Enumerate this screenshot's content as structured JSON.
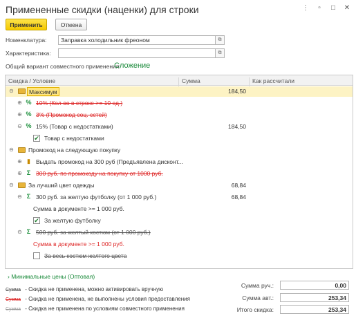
{
  "window": {
    "title": "Примененные скидки (наценки) для строки",
    "menu_glyph": "⋮",
    "restore_glyph": "▫",
    "maximize_glyph": "□",
    "close_glyph": "✕"
  },
  "toolbar": {
    "apply_label": "Применить",
    "cancel_label": "Отмена"
  },
  "form": {
    "nomenclature_label": "Номенклатура:",
    "nomenclature_value": "Заправка холодильник фреоном",
    "characteristic_label": "Характеристика:",
    "characteristic_value": "",
    "mode_label": "Общий вариант совместного применения:",
    "mode_value": "Сложение"
  },
  "grid": {
    "columns": [
      "Скидка / Условие",
      "Сумма",
      "Как рассчитали"
    ],
    "rows": [
      {
        "text": "Максимум",
        "amount": "184,50"
      },
      {
        "text": "10% (Кол-во в строке >= 10 ед.)",
        "amount": ""
      },
      {
        "text": "3% (Промокод соц. сетей)",
        "amount": ""
      },
      {
        "text": "15% (Товар с недостатками)",
        "amount": "184,50"
      },
      {
        "text": "Товар с недостатками",
        "amount": ""
      },
      {
        "text": "Промокод на следующую покупку",
        "amount": ""
      },
      {
        "text": "Выдать промокод на 300 руб  (Предъявлена дисконт...",
        "amount": ""
      },
      {
        "text": "300 руб. по промокоду на покупку от 1000 руб.",
        "amount": ""
      },
      {
        "text": "За лучший цвет одежды",
        "amount": "68,84"
      },
      {
        "text": "300 руб. за желтую футболку (от 1 000 руб.)",
        "amount": "68,84"
      },
      {
        "text": "Сумма в документе >= 1 000 руб.",
        "amount": ""
      },
      {
        "text": "За желтую футболку",
        "amount": ""
      },
      {
        "text": "500 руб. за желтый костюм (от 1 000 руб.)",
        "amount": ""
      },
      {
        "text": "Сумма в документе >= 1 000 руб.",
        "amount": ""
      },
      {
        "text": "За весь костюм желтого цвета",
        "amount": ""
      }
    ]
  },
  "footer": {
    "min_prices_label": "Минимальные цены (Оптовая)",
    "legend_sample": "Сумма",
    "legend": [
      "- Скидка не применена, можно активировать вручную",
      "- Скидка не применена, не выполнены условия предоставления",
      "- Скидка не применена по условиям совместного применения"
    ],
    "manual_label": "Сумма руч.:",
    "manual_value": "0,00",
    "auto_label": "Сумма авт.:",
    "auto_value": "253,34",
    "total_label": "Итого скидка:",
    "total_value": "253,34"
  },
  "colors": {
    "accent_yellow": "#f5c900",
    "green": "#1a8a3a",
    "red": "#d22222"
  }
}
